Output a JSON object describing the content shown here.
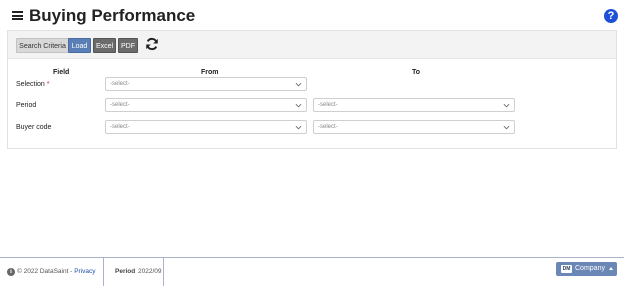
{
  "header": {
    "title": "Buying Performance",
    "help_symbol": "?"
  },
  "toolbar": {
    "search_criteria_label": "Search Criteria",
    "load_label": "Load",
    "excel_label": "Excel",
    "pdf_label": "PDF",
    "refresh_icon": "refresh-icon"
  },
  "form": {
    "col_field": "Field",
    "col_from": "From",
    "col_to": "To",
    "rows": [
      {
        "label": "Selection",
        "required_mark": "*",
        "from_placeholder": "-select-"
      },
      {
        "label": "Period",
        "from_placeholder": "-select-",
        "to_placeholder": "-select-"
      },
      {
        "label": "Buyer code",
        "from_placeholder": "-select-",
        "to_placeholder": "-select-"
      }
    ]
  },
  "footer": {
    "copyright": "© 2022 DataSaint - ",
    "privacy_label": "Privacy",
    "period_label": "Period",
    "period_value": "2022/09",
    "company_badge": "DM",
    "company_label": "Company"
  },
  "colors": {
    "load_button": "#5a7fb6",
    "dark_button": "#6b6b6b",
    "help_icon": "#1d4fd8",
    "company_button": "#6b87b6",
    "required": "#d22222"
  }
}
